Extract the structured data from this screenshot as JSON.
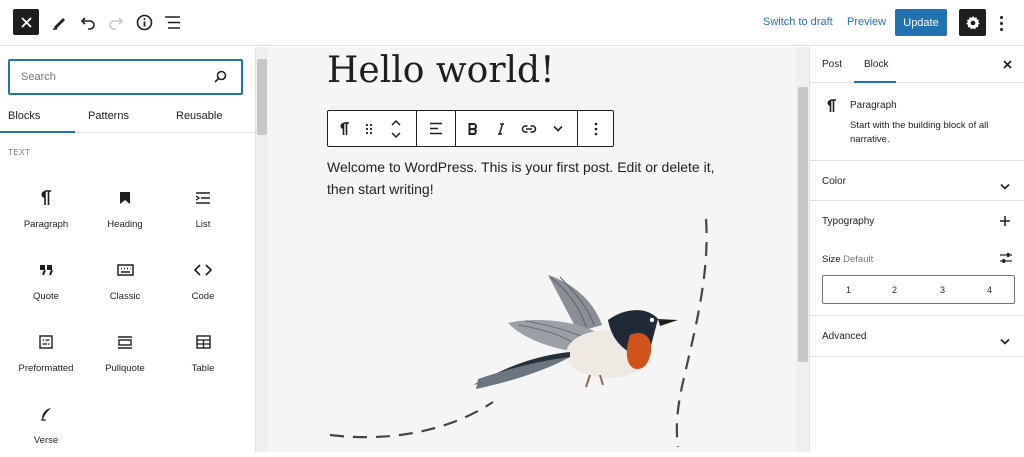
{
  "topbar": {
    "switch_draft_label": "Switch to draft",
    "preview_label": "Preview",
    "update_label": "Update",
    "accent_color": "#2271b1"
  },
  "inserter": {
    "search_placeholder": "Search",
    "tabs": [
      {
        "label": "Blocks"
      },
      {
        "label": "Patterns"
      },
      {
        "label": "Reusable"
      }
    ],
    "category": "TEXT",
    "blocks": [
      {
        "label": "Paragraph",
        "icon": "paragraph-icon"
      },
      {
        "label": "Heading",
        "icon": "heading-icon"
      },
      {
        "label": "List",
        "icon": "list-icon"
      },
      {
        "label": "Quote",
        "icon": "quote-icon"
      },
      {
        "label": "Classic",
        "icon": "classic-icon"
      },
      {
        "label": "Code",
        "icon": "code-icon"
      },
      {
        "label": "Preformatted",
        "icon": "preformatted-icon"
      },
      {
        "label": "Pullquote",
        "icon": "pullquote-icon"
      },
      {
        "label": "Table",
        "icon": "table-icon"
      },
      {
        "label": "Verse",
        "icon": "verse-icon"
      }
    ]
  },
  "editor": {
    "post_title": "Hello world!",
    "paragraph": "Welcome to WordPress. This is your first post. Edit or delete it, then start writing!"
  },
  "sidebar": {
    "tabs": [
      {
        "label": "Post"
      },
      {
        "label": "Block"
      }
    ],
    "block_card": {
      "title": "Paragraph",
      "description": "Start with the building block of all narrative."
    },
    "panels": {
      "color": "Color",
      "typography": "Typography",
      "advanced": "Advanced"
    },
    "size_label": "Size",
    "size_value": "Default",
    "size_options": [
      "1",
      "2",
      "3",
      "4"
    ]
  }
}
